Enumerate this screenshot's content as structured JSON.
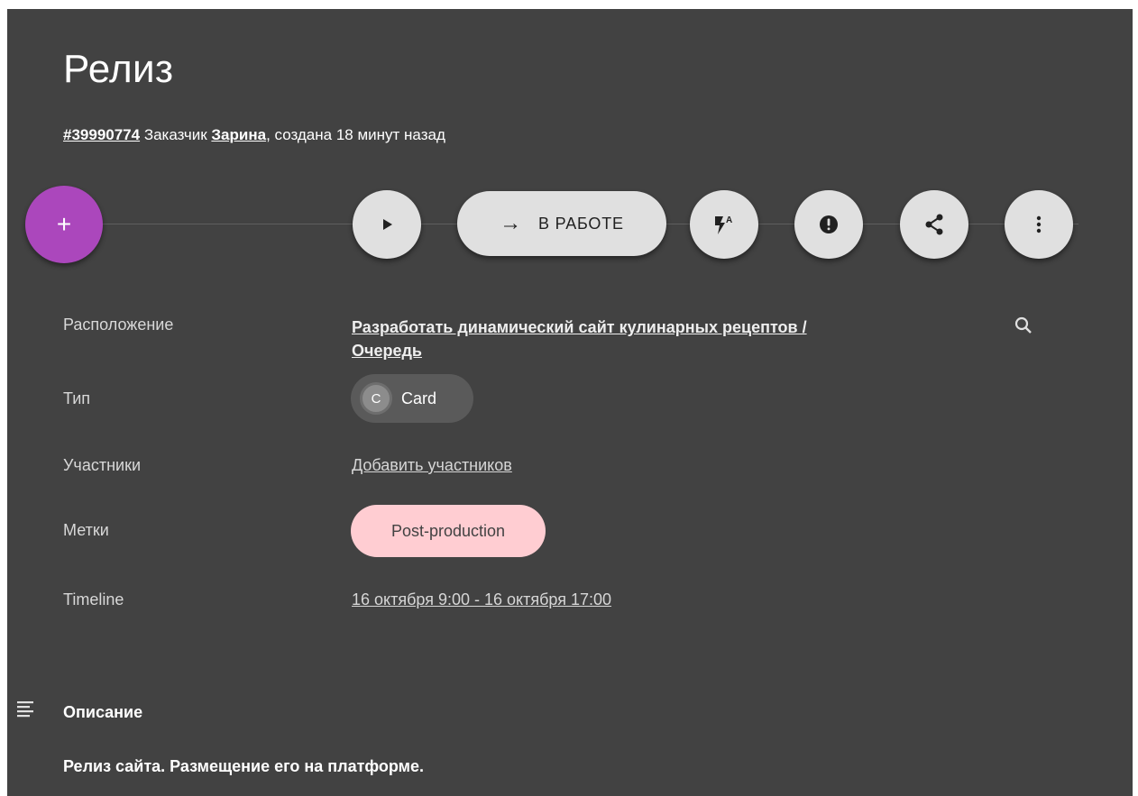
{
  "header": {
    "title": "Релиз",
    "task_id": "#39990774",
    "customer_prefix": "Заказчик",
    "customer_name": "Зарина",
    "created_suffix": ", создана 18 минут назад"
  },
  "actions": {
    "add_icon": "plus-icon",
    "add_symbol": "+",
    "status_button_label": "В РАБОТЕ",
    "status_arrow": "→",
    "play_icon": "play-icon",
    "automation_icon": "flash-auto-icon",
    "alert_icon": "alert-circle-icon",
    "share_icon": "share-icon",
    "more_icon": "more-vertical-icon"
  },
  "fields": {
    "location_label": "Расположение",
    "location_value_line1": "Разработать динамический сайт кулинарных рецептов /",
    "location_value_line2": "Очередь",
    "type_label": "Тип",
    "type_avatar": "C",
    "type_value": "Card",
    "participants_label": "Участники",
    "participants_value": "Добавить участников",
    "tags_label": "Метки",
    "tag_value": "Post-production",
    "timeline_label": "Timeline",
    "timeline_value": "16 октября 9:00 - 16 октября 17:00"
  },
  "description": {
    "title": "Описание",
    "text": "Релиз сайта. Размещение его на платформе."
  },
  "colors": {
    "panel_bg": "#424242",
    "fab": "#ab47bc",
    "button_bg": "#e0e0e0",
    "tag_bg": "#ffcdd2"
  }
}
